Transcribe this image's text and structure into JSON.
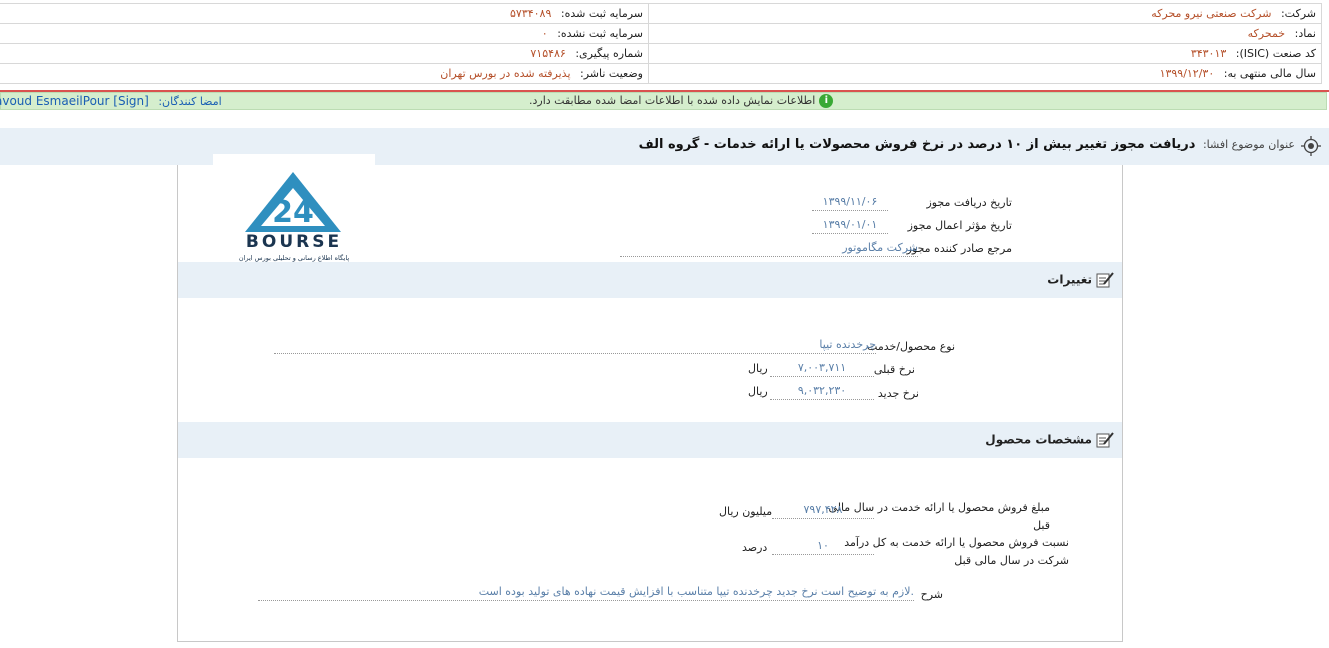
{
  "header": {
    "company_label": "شرکت:",
    "company_value": "شرکت صنعتی نیرو محرکه",
    "registered_capital_label": "سرمایه ثبت شده:",
    "registered_capital_value": "۵۷۳۴۰۸۹",
    "symbol_label": "نماد:",
    "symbol_value": "خمحرکه",
    "unregistered_capital_label": "سرمایه ثبت نشده:",
    "unregistered_capital_value": "۰",
    "isic_label": "کد صنعت (ISIC):",
    "isic_value": "۳۴۳۰۱۳",
    "tracking_label": "شماره پیگیری:",
    "tracking_value": "۷۱۵۴۸۶",
    "fiscal_label": "سال مالی منتهی به:",
    "fiscal_value": "۱۳۹۹/۱۲/۳۰",
    "publisher_status_label": "وضعیت ناشر:",
    "publisher_status_value": "پذیرفته شده در بورس تهران"
  },
  "sign_bar": {
    "signers_label": "امضا کنندگان:",
    "signer_name": "avoud EsmaeilPour [Sign]",
    "notice": "اطلاعات نمایش داده شده با اطلاعات امضا شده مطابقت دارد.",
    "info_glyph": "i"
  },
  "subject": {
    "label": "عنوان موضوع افشا:",
    "title": "دریافت مجوز تغییر بیش از ۱۰ درصد در نرخ فروش محصولات یا ارائه خدمات - گروه الف"
  },
  "logo": {
    "brand_text": "BOURSE",
    "caption": "پایگاه اطلاع رسانی و تحلیلی بورس ایران"
  },
  "permit": {
    "received_date_label": "تاریخ دریافت مجوز",
    "received_date_value": "۱۳۹۹/۱۱/۰۶",
    "effective_date_label": "تاریخ مؤثر اعمال مجوز",
    "effective_date_value": "۱۳۹۹/۰۱/۰۱",
    "issuer_label": "مرجع صادر کننده مجوز",
    "issuer_value": "شرکت مگاموتور"
  },
  "changes": {
    "title": "تغییرات",
    "product_label": "نوع محصول/خدمت",
    "product_value": "چرخدنده تیپا",
    "old_rate_label": "نرخ قبلی",
    "old_rate_value": "۷,۰۰۳,۷۱۱",
    "old_rate_unit": "ریال",
    "new_rate_label": "نرخ جدید",
    "new_rate_value": "۹,۰۳۲,۲۳۰",
    "new_rate_unit": "ریال"
  },
  "product_spec": {
    "title": "مشخصات محصول",
    "sales_label_line1": "مبلغ فروش محصول یا ارائه خدمت در سال مالی",
    "sales_label_line2": "قبل",
    "sales_value": "۷۹۷,۴۲۸",
    "sales_unit": "میلیون ریال",
    "ratio_label_line1": "نسبت فروش محصول یا ارائه خدمت به کل درآمد",
    "ratio_label_line2": "شرکت در سال مالی قبل",
    "ratio_value": "۱۰",
    "ratio_unit": "درصد",
    "description_label": "شرح",
    "description_value": "لازم به توضیح است نرخ جدید چرخدنده تیپا متناسب با افزایش قیمت نهاده های تولید بوده است."
  },
  "colors": {
    "accent_red": "#d9534f",
    "sign_bar_bg": "#d5eecd",
    "section_bg": "#e8f0f7",
    "value_orange": "#b5502a",
    "value_blue": "#5a7fa8",
    "logo_blue": "#2f8fbf"
  },
  "icons": {
    "subject": "target-icon",
    "section": "edit-note-icon",
    "info": "info-icon"
  }
}
